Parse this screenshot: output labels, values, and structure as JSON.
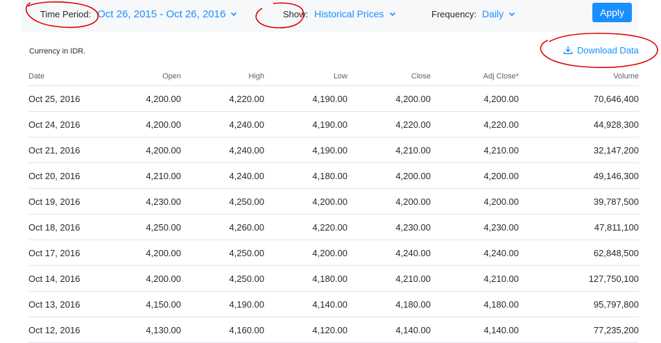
{
  "filters": {
    "time_period_label": "Time Period:",
    "time_period_value": "Oct 26, 2015 - Oct 26, 2016",
    "show_label": "Show:",
    "show_value": "Historical Prices",
    "frequency_label": "Frequency:",
    "frequency_value": "Daily",
    "apply_label": "Apply"
  },
  "currency_note": "Currency in IDR.",
  "download_label": "Download Data",
  "icons": [
    "chevron-down-icon",
    "download-icon"
  ],
  "colors": {
    "accent": "#188fff",
    "annotation": "#e00000"
  },
  "table": {
    "headers": [
      "Date",
      "Open",
      "High",
      "Low",
      "Close",
      "Adj Close*",
      "Volume"
    ],
    "rows": [
      [
        "Oct 25, 2016",
        "4,200.00",
        "4,220.00",
        "4,190.00",
        "4,200.00",
        "4,200.00",
        "70,646,400"
      ],
      [
        "Oct 24, 2016",
        "4,200.00",
        "4,240.00",
        "4,190.00",
        "4,220.00",
        "4,220.00",
        "44,928,300"
      ],
      [
        "Oct 21, 2016",
        "4,200.00",
        "4,240.00",
        "4,190.00",
        "4,210.00",
        "4,210.00",
        "32,147,200"
      ],
      [
        "Oct 20, 2016",
        "4,210.00",
        "4,240.00",
        "4,180.00",
        "4,200.00",
        "4,200.00",
        "49,146,300"
      ],
      [
        "Oct 19, 2016",
        "4,230.00",
        "4,250.00",
        "4,200.00",
        "4,200.00",
        "4,200.00",
        "39,787,500"
      ],
      [
        "Oct 18, 2016",
        "4,250.00",
        "4,260.00",
        "4,220.00",
        "4,230.00",
        "4,230.00",
        "47,811,100"
      ],
      [
        "Oct 17, 2016",
        "4,200.00",
        "4,250.00",
        "4,200.00",
        "4,240.00",
        "4,240.00",
        "62,848,500"
      ],
      [
        "Oct 14, 2016",
        "4,200.00",
        "4,250.00",
        "4,180.00",
        "4,210.00",
        "4,210.00",
        "127,750,100"
      ],
      [
        "Oct 13, 2016",
        "4,150.00",
        "4,190.00",
        "4,140.00",
        "4,180.00",
        "4,180.00",
        "95,797,800"
      ],
      [
        "Oct 12, 2016",
        "4,130.00",
        "4,160.00",
        "4,120.00",
        "4,140.00",
        "4,140.00",
        "77,235,200"
      ]
    ]
  }
}
